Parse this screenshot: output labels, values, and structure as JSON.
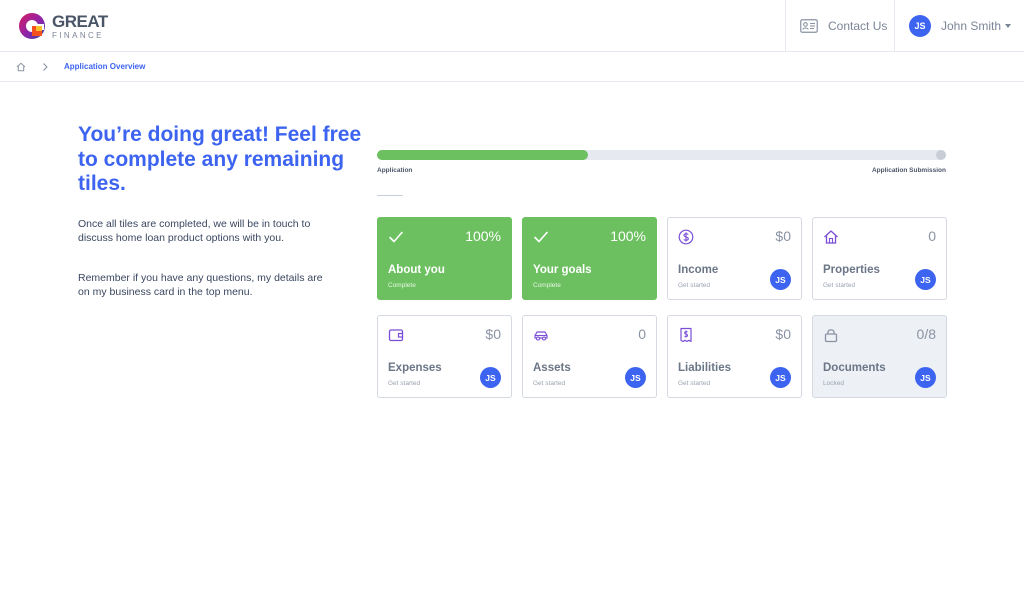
{
  "header": {
    "logo_great": "GREAT",
    "logo_finance": "FINANCE",
    "contact_label": "Contact Us",
    "user_initials": "JS",
    "user_name": "John Smith"
  },
  "breadcrumb": {
    "current": "Application Overview"
  },
  "intro": {
    "headline": "You’re doing great! Feel free to complete any remaining tiles.",
    "paragraph1": "Once all tiles are completed, we will be in touch to discuss home loan product options with you.",
    "paragraph2": "Remember if you have any questions, my details are on my business card in the top menu."
  },
  "progress": {
    "percent": 37,
    "label_start": "Application",
    "label_end": "Application Submission"
  },
  "colors": {
    "primary": "#3d64f0",
    "complete": "#6cc060"
  },
  "tiles": [
    {
      "icon": "check-icon",
      "value": "100%",
      "title": "About you",
      "status": "Complete",
      "state": "complete",
      "avatar": ""
    },
    {
      "icon": "check-icon",
      "value": "100%",
      "title": "Your goals",
      "status": "Complete",
      "state": "complete",
      "avatar": ""
    },
    {
      "icon": "dollar-icon",
      "value": "$0",
      "title": "Income",
      "status": "Get started",
      "state": "todo",
      "avatar": "JS"
    },
    {
      "icon": "house-icon",
      "value": "0",
      "title": "Properties",
      "status": "Get started",
      "state": "todo",
      "avatar": "JS"
    },
    {
      "icon": "wallet-icon",
      "value": "$0",
      "title": "Expenses",
      "status": "Get started",
      "state": "todo",
      "avatar": "JS"
    },
    {
      "icon": "car-icon",
      "value": "0",
      "title": "Assets",
      "status": "Get started",
      "state": "todo",
      "avatar": "JS"
    },
    {
      "icon": "bill-icon",
      "value": "$0",
      "title": "Liabilities",
      "status": "Get started",
      "state": "todo",
      "avatar": "JS"
    },
    {
      "icon": "lock-icon",
      "value": "0/8",
      "title": "Documents",
      "status": "Locked",
      "state": "locked",
      "avatar": "JS"
    }
  ]
}
